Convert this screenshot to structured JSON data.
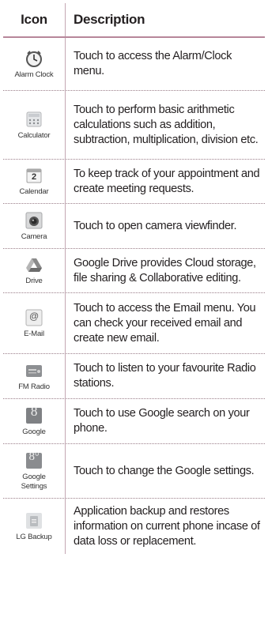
{
  "header": {
    "icon_col": "Icon",
    "desc_col": "Description"
  },
  "rows": [
    {
      "icon": "alarm-clock-icon",
      "label": "Alarm Clock",
      "desc": "Touch to access the Alarm/Clock menu."
    },
    {
      "icon": "calculator-icon",
      "label": "Calculator",
      "desc": "Touch to perform basic arithmetic calculations such as addition, subtraction, multiplication, division etc."
    },
    {
      "icon": "calendar-icon",
      "label": "Calendar",
      "icon_text": "2",
      "desc": "To keep track of your appointment and create meeting requests."
    },
    {
      "icon": "camera-icon",
      "label": "Camera",
      "desc": "Touch to open camera viewfinder."
    },
    {
      "icon": "drive-icon",
      "label": "Drive",
      "desc": "Google Drive provides Cloud storage, file sharing & Collaborative editing."
    },
    {
      "icon": "email-icon",
      "label": "E-Mail",
      "icon_text": "@",
      "desc": "Touch to access the Email menu. You can check your received email and create new email."
    },
    {
      "icon": "fm-radio-icon",
      "label": "FM Radio",
      "desc": "Touch to listen to your  favourite Radio stations."
    },
    {
      "icon": "google-icon",
      "label": "Google",
      "icon_text": "8",
      "desc": "Touch to use Google search on your phone."
    },
    {
      "icon": "google-settings-icon",
      "label": "Google Settings",
      "icon_text": "8°",
      "desc": "Touch to change the Google settings."
    },
    {
      "icon": "lg-backup-icon",
      "label": "LG Backup",
      "desc": "Application backup and restores information on current phone incase of data loss or replacement."
    }
  ]
}
